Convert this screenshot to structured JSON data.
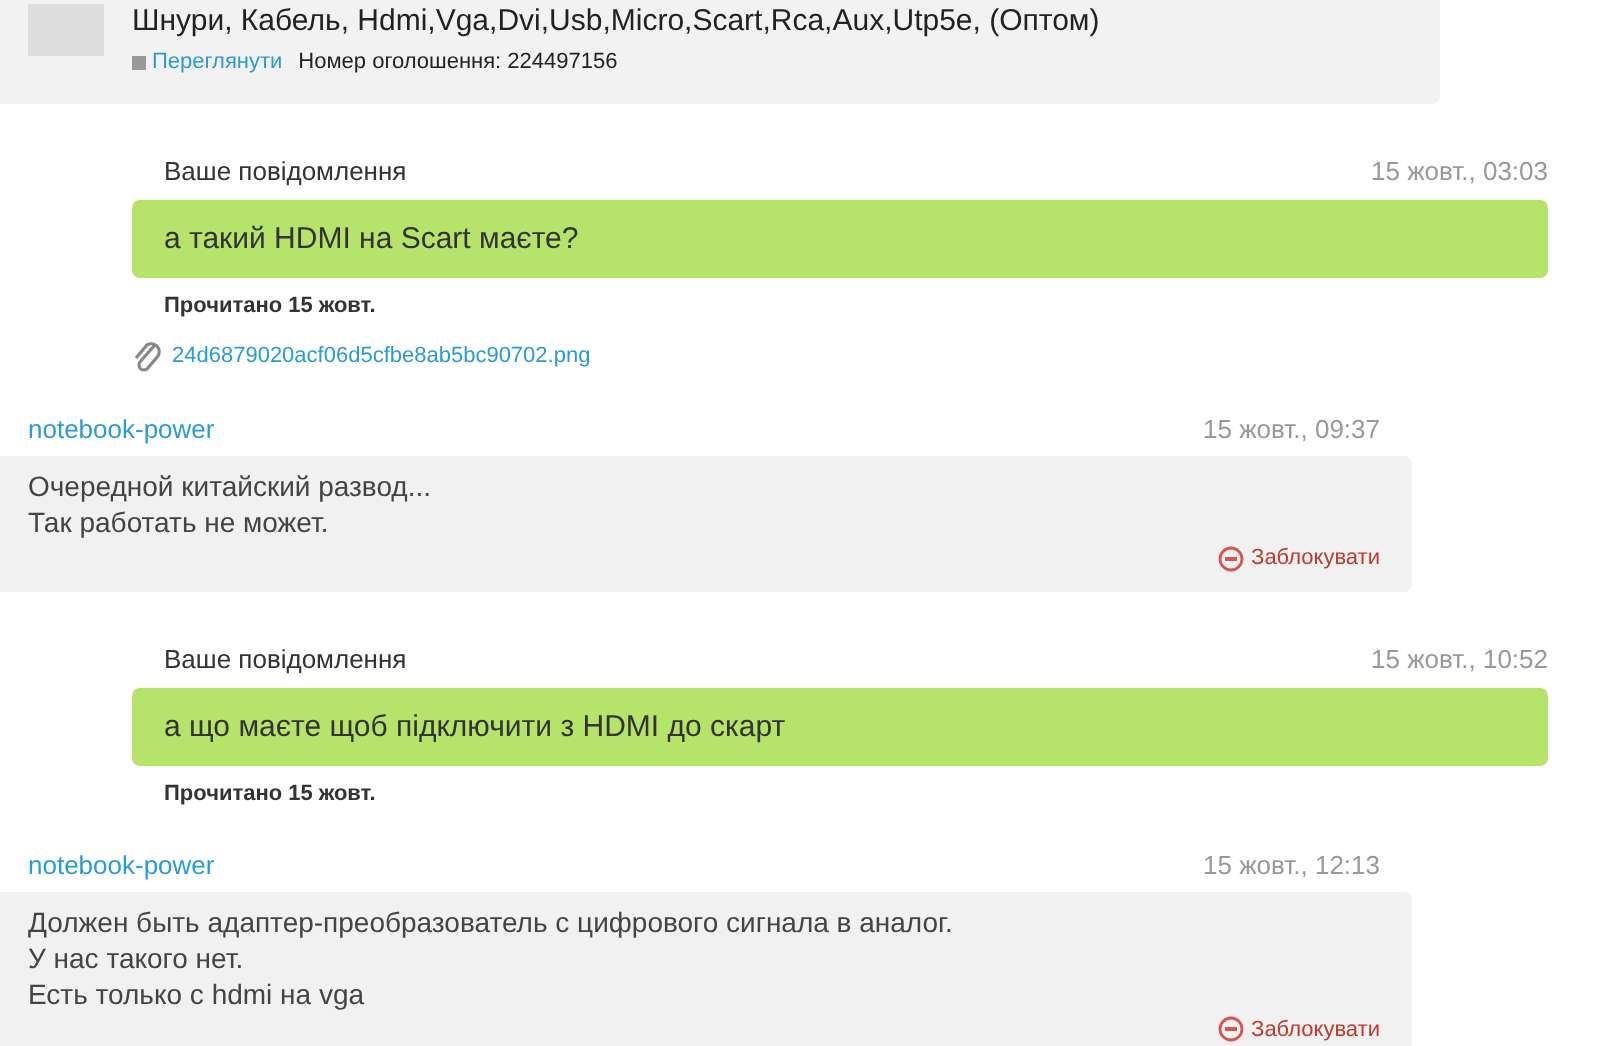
{
  "listing": {
    "title": "Шнури, Кабель, Hdmi,Vga,Dvi,Usb,Micro,Scart,Rca,Aux,Utp5e, (Оптом)",
    "view_link": "Переглянути",
    "ad_number": "Номер оголошення: 224497156"
  },
  "messages": [
    {
      "kind": "own",
      "author": "Ваше повідомлення",
      "time": "15 жовт., 03:03",
      "lines": [
        "а такий HDMI на Scart маєте?"
      ],
      "read": "Прочитано 15 жовт.",
      "attachment": "24d6879020acf06d5cfbe8ab5bc90702.png"
    },
    {
      "kind": "other",
      "author": "notebook-power",
      "time": "15 жовт., 09:37",
      "lines": [
        "Очередной китайский развод...",
        "Так работать не может."
      ],
      "block": "Заблокувати"
    },
    {
      "kind": "own",
      "author": "Ваше повідомлення",
      "time": "15 жовт., 10:52",
      "lines": [
        "а що маєте щоб підключити з HDMI до скарт"
      ],
      "read": "Прочитано 15 жовт."
    },
    {
      "kind": "other",
      "author": "notebook-power",
      "time": "15 жовт., 12:13",
      "lines": [
        "Должен быть адаптер-преобразователь с цифрового сигнала в аналог.",
        "У нас такого нет.",
        "Есть только с hdmi на vga"
      ],
      "block": "Заблокувати"
    }
  ]
}
